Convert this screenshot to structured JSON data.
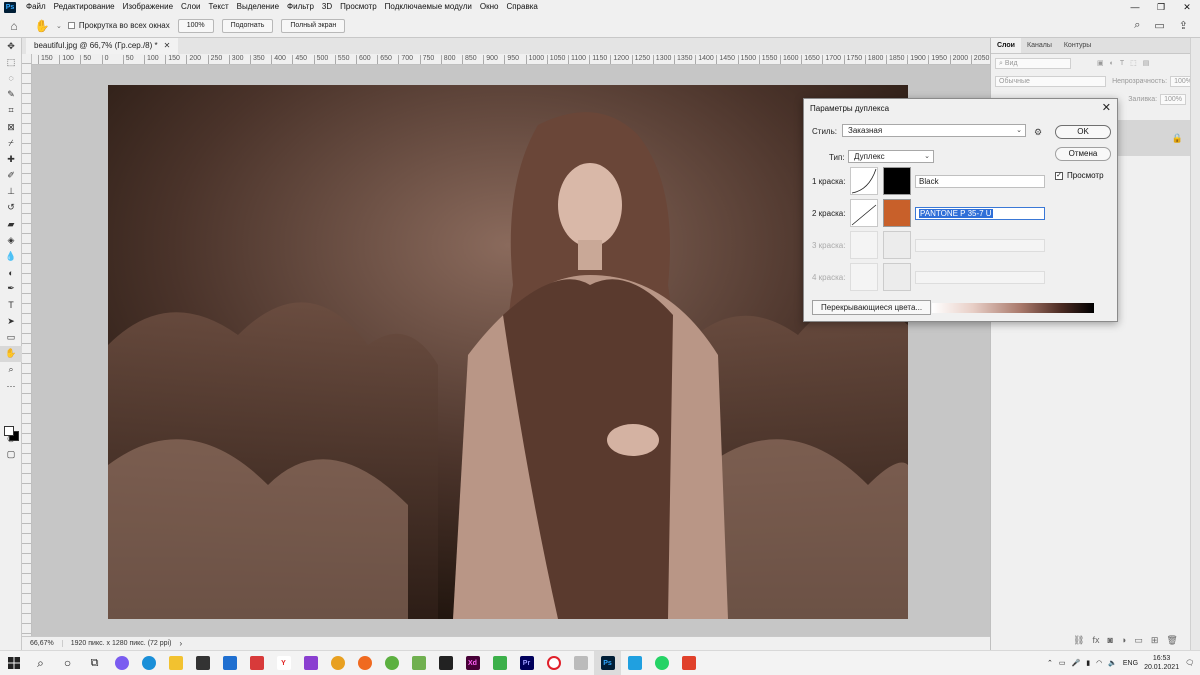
{
  "app": {
    "logo": "Ps",
    "menu": [
      "Файл",
      "Редактирование",
      "Изображение",
      "Слои",
      "Текст",
      "Выделение",
      "Фильтр",
      "3D",
      "Просмотр",
      "Подключаемые модули",
      "Окно",
      "Справка"
    ]
  },
  "options_bar": {
    "scroll_all_windows": "Прокрутка во всех окнах",
    "zoom_100": "100%",
    "fit_screen": "Подогнать",
    "full_screen": "Полный экран"
  },
  "document": {
    "tab_title": "beautiful.jpg @ 66,7% (Гр.сер./8) *",
    "ruler_ticks": [
      "150",
      "100",
      "50",
      "0",
      "50",
      "100",
      "150",
      "200",
      "250",
      "300",
      "350",
      "400",
      "450",
      "500",
      "550",
      "600",
      "650",
      "700",
      "750",
      "800",
      "850",
      "900",
      "950",
      "1000",
      "1050",
      "1100",
      "1150",
      "1200",
      "1250",
      "1300",
      "1350",
      "1400",
      "1450",
      "1500",
      "1550",
      "1600",
      "1650",
      "1700",
      "1750",
      "1800",
      "1850",
      "1900",
      "1950",
      "2000",
      "2050"
    ]
  },
  "status_bar": {
    "zoom": "66,67%",
    "info": "1920 пикс. x 1280 пикс. (72 ppi)"
  },
  "layers_panel": {
    "tabs": [
      "Слои",
      "Каналы",
      "Контуры"
    ],
    "kind_filter": "Вид",
    "blend_mode": "Обычные",
    "opacity_label": "Непрозрачность:",
    "opacity_value": "100%",
    "fill_label": "Заливка:",
    "fill_value": "100%"
  },
  "duotone_dialog": {
    "title": "Параметры дуплекса",
    "preset_label": "Стиль:",
    "preset_value": "Заказная",
    "type_label": "Тип:",
    "type_value": "Дуплекс",
    "ok_label": "OK",
    "cancel_label": "Отмена",
    "preview_label": "Просмотр",
    "inks": [
      {
        "label": "1 краска:",
        "name": "Black",
        "color": "#000000",
        "enabled": true
      },
      {
        "label": "2 краска:",
        "name": "PANTONE P 35-7 U",
        "color": "#c8602a",
        "enabled": true
      },
      {
        "label": "3 краска:",
        "name": "",
        "color": "#ececec",
        "enabled": false
      },
      {
        "label": "4 краска:",
        "name": "",
        "color": "#ececec",
        "enabled": false
      }
    ],
    "overprint_label": "Перекрывающиеся цвета..."
  },
  "taskbar": {
    "language": "ENG",
    "time": "16:53",
    "date": "20.01.2021"
  }
}
